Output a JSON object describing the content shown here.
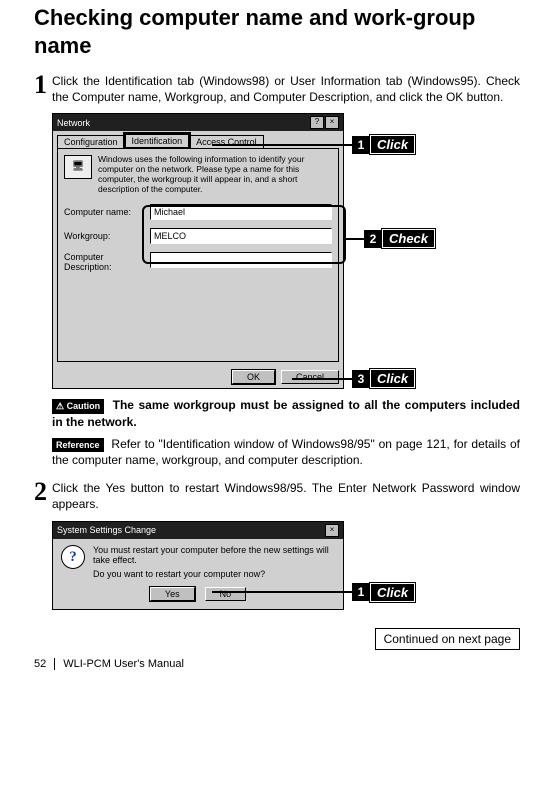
{
  "heading": "Checking computer name and work-group name",
  "steps": {
    "s1": {
      "num": "1",
      "text": "Click the Identification tab (Windows98) or User Information tab (Windows95).  Check the Computer name, Workgroup, and Computer Description, and click the OK button."
    },
    "s2": {
      "num": "2",
      "text": "Click the Yes button to restart Windows98/95.  The Enter Network Password window appears."
    }
  },
  "dlg1": {
    "title": "Network",
    "tabs": {
      "t1": "Configuration",
      "t2": "Identification",
      "t3": "Access Control"
    },
    "intro": "Windows uses the following information to identify your computer on the network.  Please type a name for this computer, the workgroup it will appear in, and a short description of the computer.",
    "labels": {
      "cname": "Computer name:",
      "wg": "Workgroup:",
      "cdesc": "Computer Description:"
    },
    "values": {
      "cname": "Michael",
      "wg": "MELCO",
      "cdesc": ""
    },
    "buttons": {
      "ok": "OK",
      "cancel": "Cancel"
    },
    "sys": {
      "help": "?",
      "close": "×"
    }
  },
  "dlg2": {
    "title": "System Settings Change",
    "line1": "You must restart your computer before the new settings will take effect.",
    "line2": "Do you want to restart your computer now?",
    "buttons": {
      "yes": "Yes",
      "no": "No"
    }
  },
  "callouts": {
    "c1num": "1",
    "c1label": "Click",
    "c2num": "2",
    "c2label": "Check",
    "c3num": "3",
    "c3label": "Click",
    "c4num": "1",
    "c4label": "Click"
  },
  "badges": {
    "caution": "Caution",
    "reference": "Reference"
  },
  "caution_text": "The same workgroup must be assigned to all the computers included in the network.",
  "reference_text": "Refer to \"Identification window of Windows98/95\" on page 121, for details of the computer name, workgroup, and computer description.",
  "continued": "Continued on next page",
  "footer": {
    "page": "52",
    "doc": "WLI-PCM User's Manual"
  }
}
